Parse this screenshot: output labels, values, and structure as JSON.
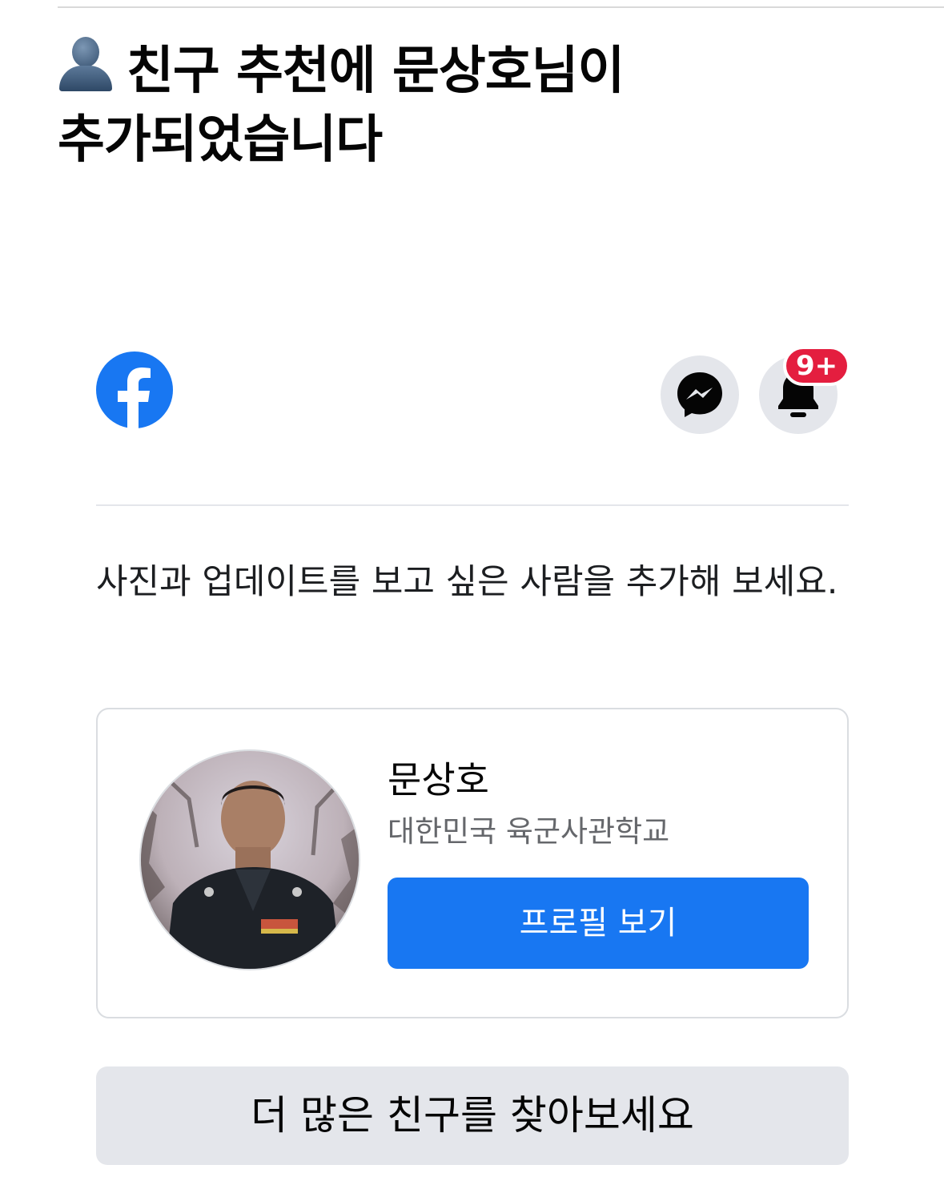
{
  "email": {
    "subject_icon": "bust-in-silhouette-icon",
    "subject_line1": "친구 추천에 문상호님이",
    "subject_line2": "추가되었습니다"
  },
  "header": {
    "logo": "facebook-logo-icon",
    "messenger_icon": "messenger-icon",
    "bell_icon": "bell-icon",
    "notification_badge": "9+",
    "brand_color": "#1877F2",
    "badge_color": "#E41E3F"
  },
  "intro": {
    "text": "사진과 업데이트를 보고 싶은 사람을 추가해 보세요."
  },
  "suggestion": {
    "avatar": "profile-photo",
    "name": "문상호",
    "school": "대한민국 육군사관학교",
    "profile_button_label": "프로필 보기"
  },
  "footer": {
    "more_friends_label": "더 많은 친구를 찾아보세요"
  }
}
